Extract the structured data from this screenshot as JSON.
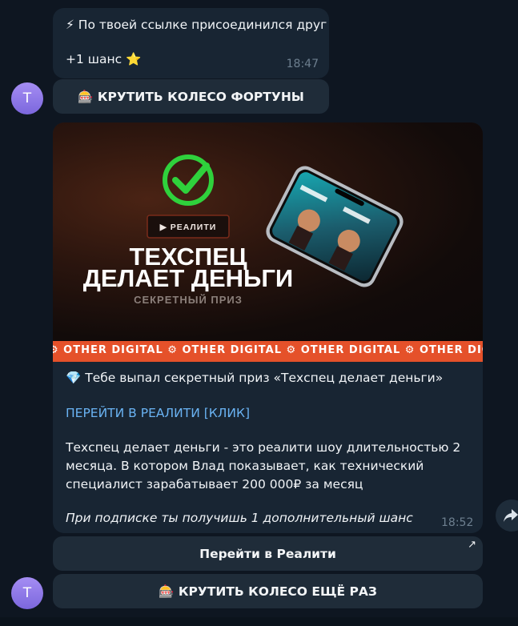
{
  "msg1": {
    "line1": "⚡ По твоей ссылке присоединился друг",
    "line2": "+1 шанс ⭐",
    "time": "18:47"
  },
  "avatar1": {
    "letter": "T"
  },
  "button_spin": {
    "label": "🎰 КРУТИТЬ КОЛЕСО ФОРТУНЫ"
  },
  "banner": {
    "tag": "▶ РЕАЛИТИ",
    "title_line1": "ТЕХСПЕЦ",
    "title_line2": "ДЕЛАЕТ ДЕНЬГИ",
    "subtitle": "СЕКРЕТНЫЙ ПРИЗ",
    "strip": "⚙ OTHER DIGITAL ⚙ OTHER DIGITAL ⚙ OTHER DIGITAL ⚙ OTHER DIGITAL ⚙ OTHER DIGITAL"
  },
  "msg2": {
    "prize": "💎 Тебе выпал секретный приз «Техспец делает деньги»",
    "link": "ПЕРЕЙТИ В РЕАЛИТИ [КЛИК]",
    "desc1": "Техспец делает деньги - это реалити шоу длительностью 2",
    "desc2": "месяца. В котором Влад показывает, как технический",
    "desc3": "специалист зарабатывает 200 000₽ за месяц",
    "note": "При подписке ты получишь 1 дополнительный шанс",
    "time": "18:52"
  },
  "button_reality": {
    "label": "Перейти в Реалити",
    "icon": "↗"
  },
  "avatar2": {
    "letter": "T"
  },
  "button_spin_again": {
    "label": "🎰 КРУТИТЬ КОЛЕСО ЕЩЁ РАЗ"
  },
  "share": {
    "icon": "share-arrow"
  },
  "colors": {
    "bg": "#0e1621",
    "bubble": "#182533",
    "link": "#6ab3f3",
    "accent": "#e5512a",
    "check": "#2fd13c"
  }
}
